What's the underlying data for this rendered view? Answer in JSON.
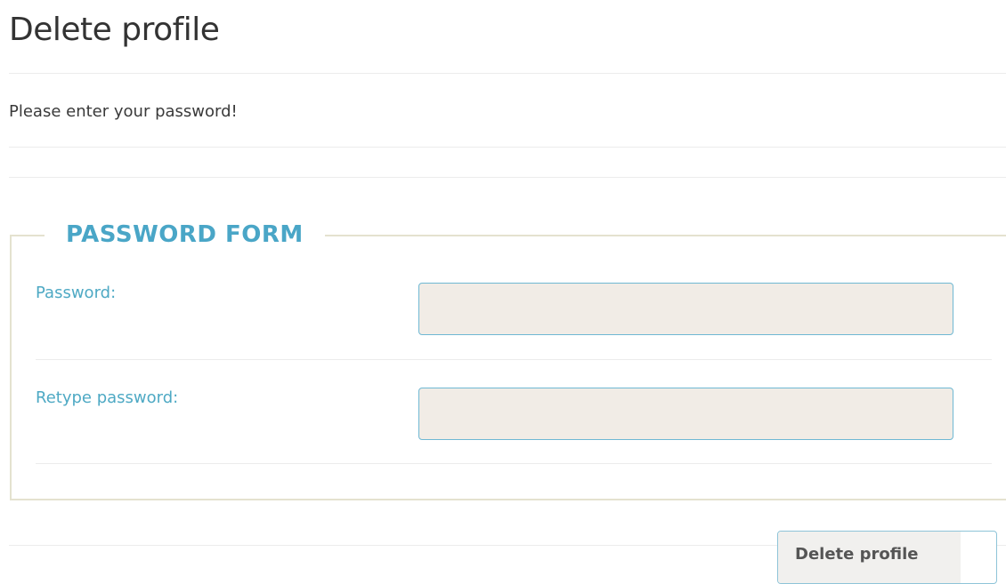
{
  "page": {
    "title": "Delete profile",
    "intro": "Please enter your password!"
  },
  "form": {
    "legend": "PASSWORD FORM",
    "fields": [
      {
        "label": "Password:",
        "value": "",
        "type": "password"
      },
      {
        "label": "Retype password:",
        "value": "",
        "type": "password"
      }
    ],
    "submit_label": "Delete profile"
  },
  "colors": {
    "accent": "#4aa6c7",
    "input_border": "#6fb8d3",
    "input_background": "#f1ece6",
    "fieldset_border": "#e4e2cf"
  }
}
